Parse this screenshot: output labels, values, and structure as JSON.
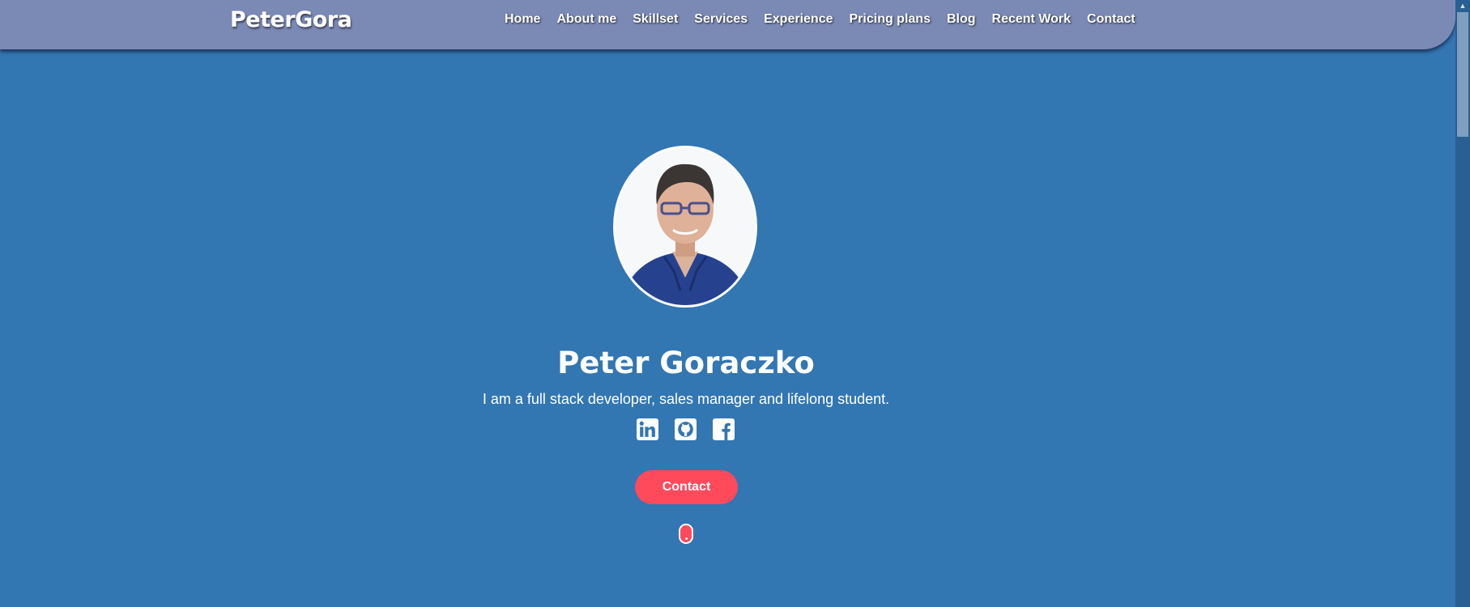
{
  "brand": {
    "logo": "PeterGora"
  },
  "nav": {
    "items": [
      {
        "label": "Home"
      },
      {
        "label": "About me"
      },
      {
        "label": "Skillset"
      },
      {
        "label": "Services"
      },
      {
        "label": "Experience"
      },
      {
        "label": "Pricing plans"
      },
      {
        "label": "Blog"
      },
      {
        "label": "Recent Work"
      },
      {
        "label": "Contact"
      }
    ]
  },
  "hero": {
    "name": "Peter Goraczko",
    "tagline": "I am a full stack developer, sales manager and lifelong student.",
    "socials": [
      {
        "icon": "linkedin-icon"
      },
      {
        "icon": "github-icon"
      },
      {
        "icon": "facebook-icon"
      }
    ],
    "contact_label": "Contact"
  },
  "colors": {
    "background": "#3276b2",
    "navbar": "#7b89b5",
    "accent": "#ff4a5c"
  }
}
